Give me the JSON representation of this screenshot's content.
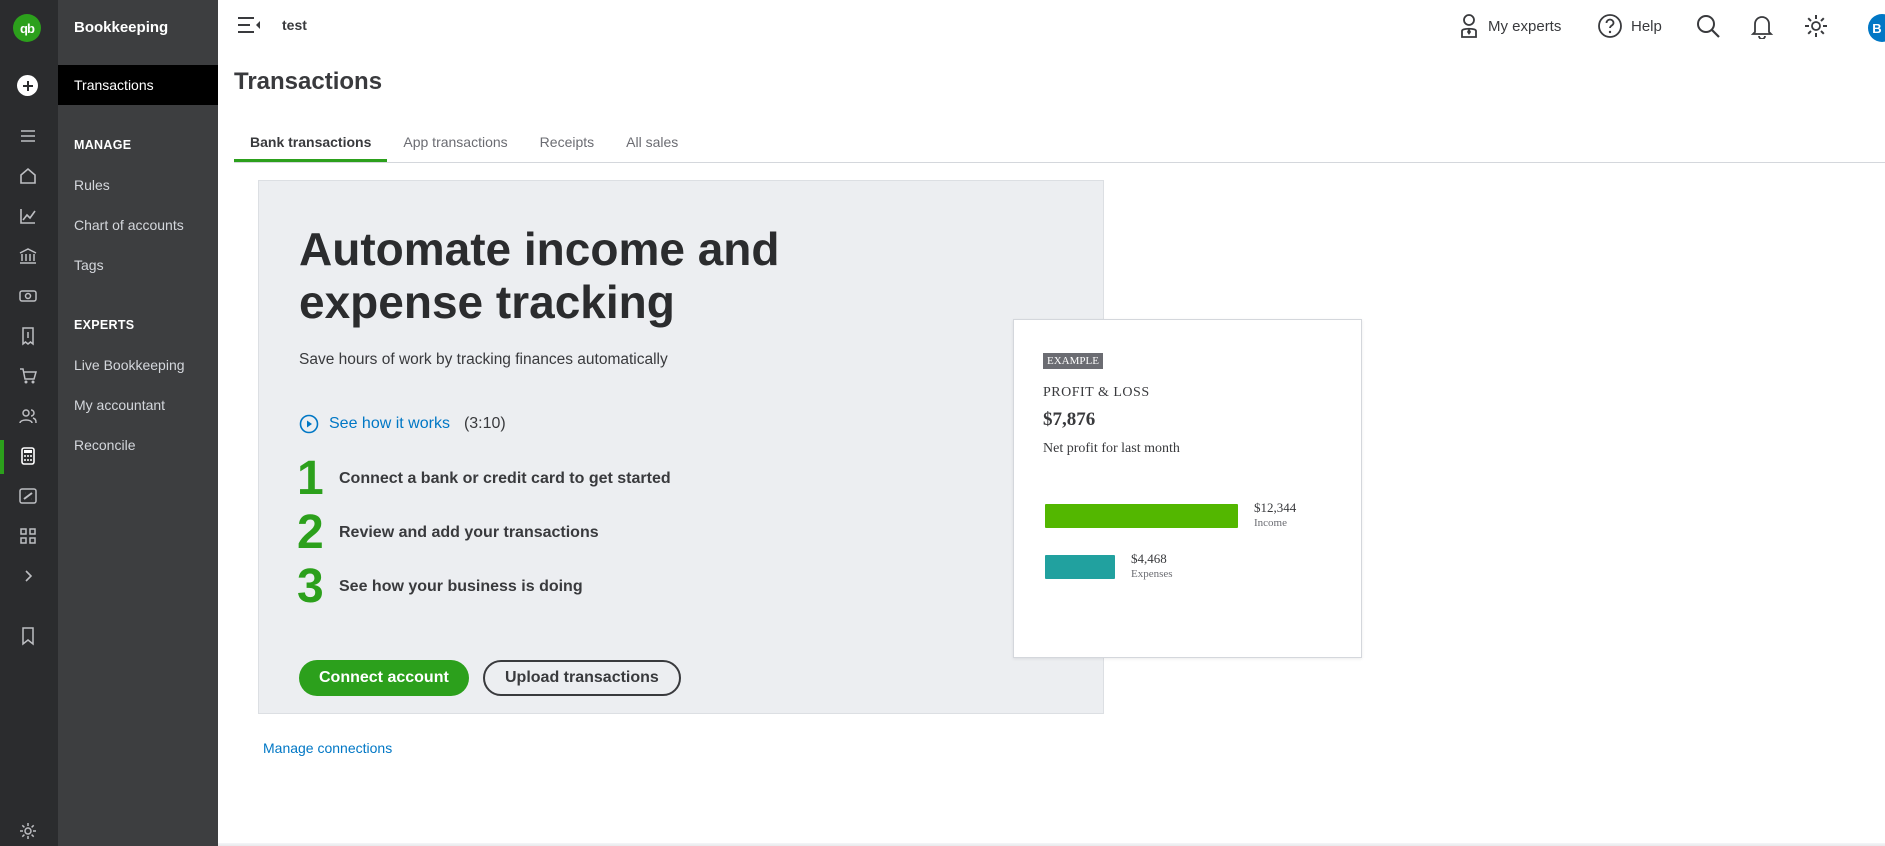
{
  "app": {
    "section_title": "Bookkeeping",
    "company_name": "test",
    "avatar_initial": "B"
  },
  "sidebar": {
    "active_item": "Transactions",
    "sections": [
      {
        "heading": "MANAGE",
        "items": [
          "Rules",
          "Chart of accounts",
          "Tags"
        ]
      },
      {
        "heading": "EXPERTS",
        "items": [
          "Live Bookkeeping",
          "My accountant",
          "Reconcile"
        ]
      }
    ]
  },
  "topbar": {
    "my_experts": "My experts",
    "help": "Help"
  },
  "page": {
    "title": "Transactions",
    "tabs": [
      {
        "label": "Bank transactions",
        "active": true
      },
      {
        "label": "App transactions"
      },
      {
        "label": "Receipts"
      },
      {
        "label": "All sales"
      }
    ]
  },
  "promo": {
    "headline": "Automate income and expense tracking",
    "subtitle": "Save hours of work by tracking finances automatically",
    "video_link": "See how it works",
    "video_duration": "(3:10)",
    "steps": [
      {
        "number": "1",
        "text": "Connect a bank or credit card to get started"
      },
      {
        "number": "2",
        "text": "Review and add your transactions"
      },
      {
        "number": "3",
        "text": "See how your business is doing"
      }
    ],
    "primary_button": "Connect account",
    "secondary_button": "Upload transactions"
  },
  "example_card": {
    "badge": "EXAMPLE",
    "label": "PROFIT & LOSS",
    "value": "$7,876",
    "description": "Net profit for last month",
    "bars": [
      {
        "value_text": "$12,344",
        "label": "Income",
        "amount": 12344,
        "color": "#53b700"
      },
      {
        "value_text": "$4,468",
        "label": "Expenses",
        "amount": 4468,
        "color": "#21a19f"
      }
    ]
  },
  "links": {
    "manage_connections": "Manage connections"
  },
  "colors": {
    "brand_green": "#2ca01c",
    "link_blue": "#0077c5",
    "rail_bg": "#2b2c2e",
    "panel_bg": "#3d3e40"
  }
}
